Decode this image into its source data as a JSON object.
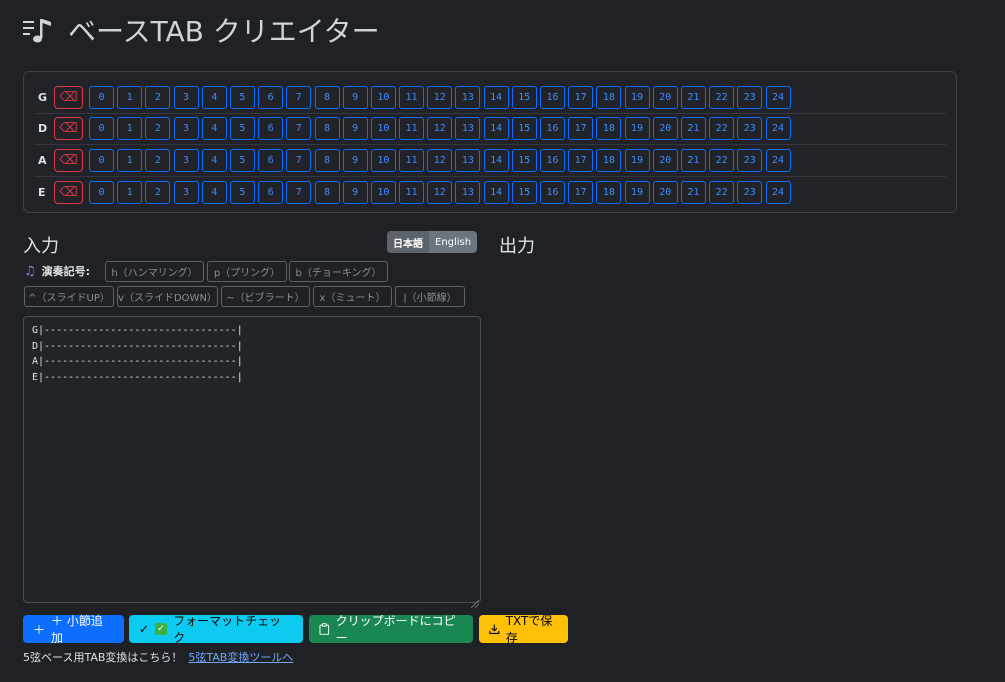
{
  "app": {
    "title": "ベースTAB クリエイター"
  },
  "fretboard": {
    "strings": [
      "G",
      "D",
      "A",
      "E"
    ],
    "delete_icon": "⌫",
    "frets": [
      "0",
      "1",
      "2",
      "3",
      "4",
      "5",
      "6",
      "7",
      "8",
      "9",
      "10",
      "11",
      "12",
      "13",
      "14",
      "15",
      "16",
      "17",
      "18",
      "19",
      "20",
      "21",
      "22",
      "23",
      "24"
    ]
  },
  "input_section": {
    "title": "入力"
  },
  "output_section": {
    "title": "出力"
  },
  "language": {
    "ja": "日本語",
    "en": "English",
    "selected": "日本語"
  },
  "symbols": {
    "label": "演奏記号:",
    "buttons": [
      "h（ハンマリング）",
      "p（プリング）",
      "b（チョーキング）",
      "^（スライドUP）",
      "v（スライドDOWN）",
      "~（ビブラート）",
      "x（ミュート）",
      "|（小節線）"
    ]
  },
  "editor": {
    "content": "G|--------------------------------|\nD|--------------------------------|\nA|--------------------------------|\nE|--------------------------------|"
  },
  "actions": {
    "add_measure": "＋ 小節追加",
    "format_check": "フォーマットチェック",
    "copy_clipboard": "クリップボードにコピー",
    "save_txt": "TXTで保存"
  },
  "footer": {
    "text": "5弦ベース用TAB変換はこちら！",
    "link": "5弦TAB変換ツールへ"
  },
  "colors": {
    "background": "#1f2125",
    "primary": "#0d6efd",
    "danger": "#dc3545",
    "info": "#0dcaf0",
    "success": "#198754",
    "warning": "#ffc107"
  }
}
